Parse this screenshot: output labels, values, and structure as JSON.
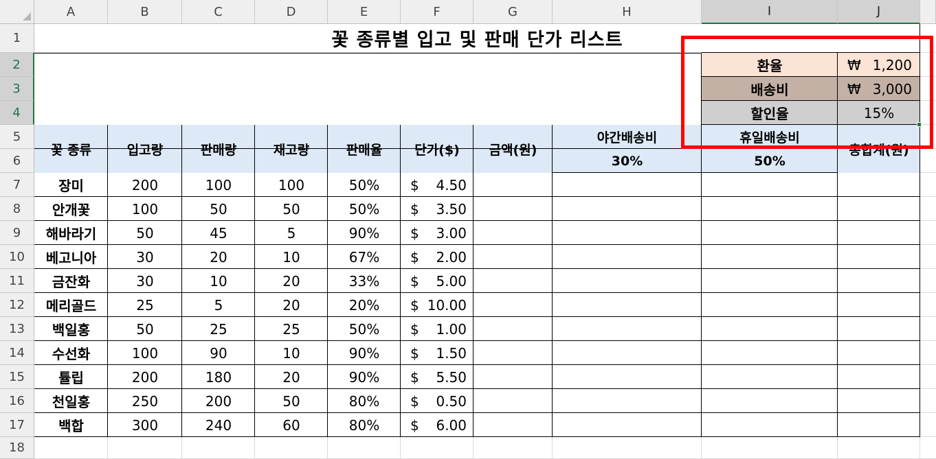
{
  "sheet": {
    "columns": [
      "A",
      "B",
      "C",
      "D",
      "E",
      "F",
      "G",
      "H",
      "I",
      "J"
    ],
    "rows": [
      "1",
      "2",
      "3",
      "4",
      "5",
      "6",
      "7",
      "8",
      "9",
      "10",
      "11",
      "12",
      "13",
      "14",
      "15",
      "16",
      "17",
      "18"
    ],
    "title": "꽃 종류별 입고 및 판매 단가 리스트"
  },
  "rates": {
    "exchange_label": "환율",
    "exchange_symbol": "₩",
    "exchange_value": "1,200",
    "shipping_label": "배송비",
    "shipping_symbol": "₩",
    "shipping_value": "3,000",
    "discount_label": "할인율",
    "discount_value": "15%"
  },
  "header": {
    "kind": "꽃 종류",
    "in": "입고량",
    "sold": "판매량",
    "stock": "재고량",
    "rate": "판매율",
    "price": "단가($)",
    "amount": "금액(원)",
    "night": "야간배송비",
    "night_pct": "30%",
    "holiday": "휴일배송비",
    "holiday_pct": "50%",
    "total": "총합계(원)"
  },
  "items": [
    {
      "name": "장미",
      "in": "200",
      "sold": "100",
      "stock": "100",
      "rate": "50%",
      "cur": "$",
      "price": "4.50"
    },
    {
      "name": "안개꽃",
      "in": "100",
      "sold": "50",
      "stock": "50",
      "rate": "50%",
      "cur": "$",
      "price": "3.50"
    },
    {
      "name": "해바라기",
      "in": "50",
      "sold": "45",
      "stock": "5",
      "rate": "90%",
      "cur": "$",
      "price": "3.00"
    },
    {
      "name": "베고니아",
      "in": "30",
      "sold": "20",
      "stock": "10",
      "rate": "67%",
      "cur": "$",
      "price": "2.00"
    },
    {
      "name": "금잔화",
      "in": "30",
      "sold": "10",
      "stock": "20",
      "rate": "33%",
      "cur": "$",
      "price": "5.00"
    },
    {
      "name": "메리골드",
      "in": "25",
      "sold": "5",
      "stock": "20",
      "rate": "20%",
      "cur": "$",
      "price": "10.00"
    },
    {
      "name": "백일홍",
      "in": "50",
      "sold": "25",
      "stock": "25",
      "rate": "50%",
      "cur": "$",
      "price": "1.00"
    },
    {
      "name": "수선화",
      "in": "100",
      "sold": "90",
      "stock": "10",
      "rate": "90%",
      "cur": "$",
      "price": "1.50"
    },
    {
      "name": "튤립",
      "in": "200",
      "sold": "180",
      "stock": "20",
      "rate": "90%",
      "cur": "$",
      "price": "5.50"
    },
    {
      "name": "천일홍",
      "in": "250",
      "sold": "200",
      "stock": "50",
      "rate": "80%",
      "cur": "$",
      "price": "0.50"
    },
    {
      "name": "백합",
      "in": "300",
      "sold": "240",
      "stock": "60",
      "rate": "80%",
      "cur": "$",
      "price": "6.00"
    }
  ],
  "colors": {
    "header_fill": "#dde9f6",
    "exchange_fill": "#fbe3d6",
    "shipping_fill": "#c4b1a5",
    "discount_fill": "#cfcfcf",
    "highlight_border": "#ff0000",
    "selection": "#217346"
  }
}
